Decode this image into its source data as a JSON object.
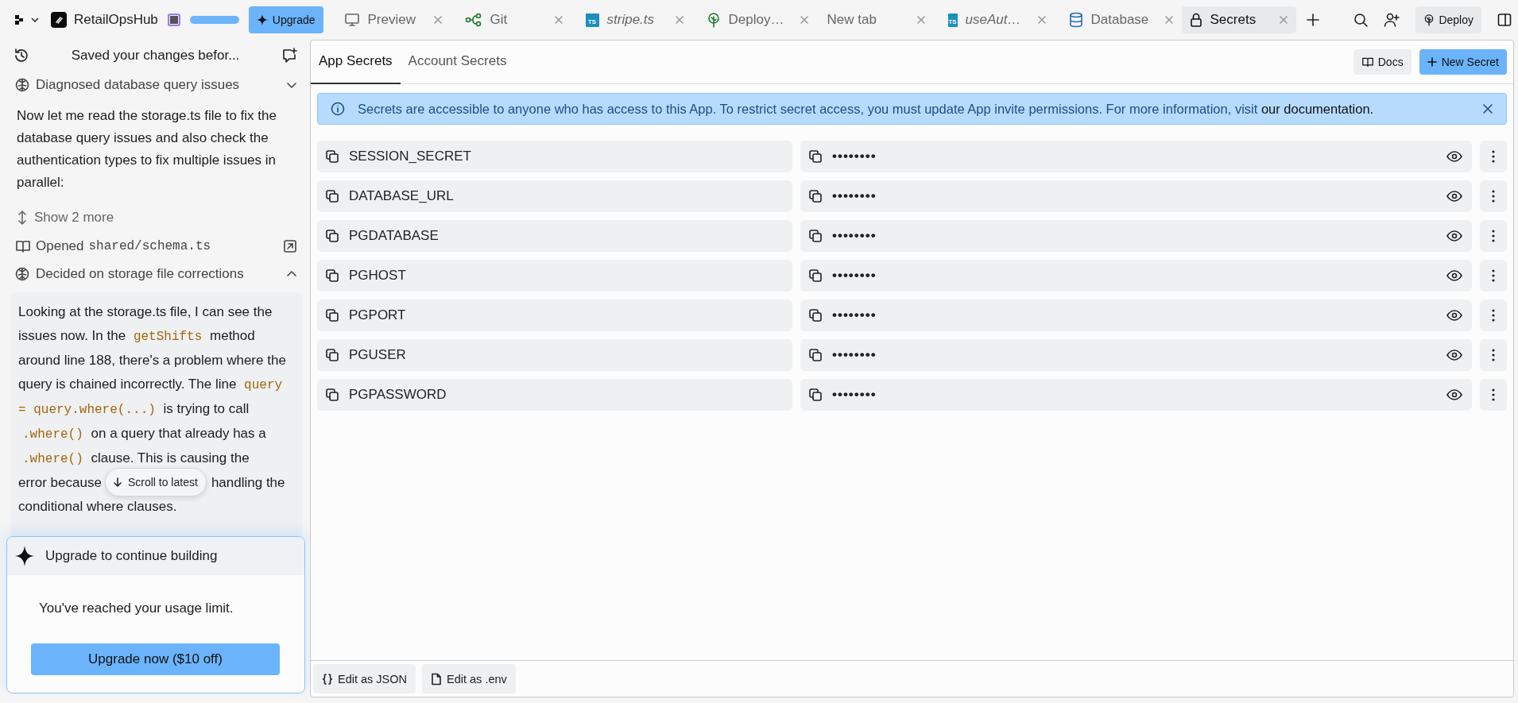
{
  "topbar": {
    "project": "RetailOpsHub",
    "upgrade": "Upgrade",
    "deploy": "Deploy",
    "tabs": [
      {
        "label": "Preview",
        "kind": "preview",
        "preview": false,
        "selected": false
      },
      {
        "label": "Git",
        "kind": "git",
        "preview": false,
        "selected": false
      },
      {
        "label": "stripe.ts",
        "kind": "file",
        "badge": "TS",
        "preview": true,
        "selected": false
      },
      {
        "label": "Deploy…",
        "kind": "deploy",
        "preview": false,
        "selected": false
      },
      {
        "label": "New tab",
        "kind": "blank",
        "preview": false,
        "selected": false
      },
      {
        "label": "useAut…",
        "kind": "file",
        "badge": "TS",
        "preview": true,
        "selected": false
      },
      {
        "label": "Database",
        "kind": "database",
        "preview": false,
        "selected": false
      },
      {
        "label": "Secrets",
        "kind": "secrets",
        "preview": false,
        "selected": true
      }
    ]
  },
  "chat": {
    "title": "Saved your changes befor...",
    "items": [
      {
        "kind": "step",
        "label": "Diagnosed database query issues",
        "expanded": false
      },
      {
        "kind": "paragraph",
        "text": "Now let me read the storage.ts file to fix the database query issues and also check the authentication types to fix multiple issues in parallel:"
      },
      {
        "kind": "more",
        "label": "Show 2 more"
      },
      {
        "kind": "file",
        "label": "Opened",
        "path": "shared/schema.ts"
      },
      {
        "kind": "step",
        "label": "Decided on storage file corrections",
        "expanded": true
      },
      {
        "kind": "card",
        "text": "Looking at the storage.ts file, I can see the issues now. In the *getShifts* method around line 188, there's a problem where the query is chained incorrectly. The line *query = query.where(...)* is trying to call *.where()* on a query that already has a *.where()* clause. This is causing the",
        "line_left": "error because",
        "line_right": "handling the",
        "text_end": "conditional where clauses.",
        "overlay": "Scroll to latest"
      }
    ],
    "upgrade_card": {
      "title": "Upgrade to continue building",
      "message": "You've reached your usage limit.",
      "button": "Upgrade now ($10 off)"
    }
  },
  "secrets": {
    "tabs": [
      {
        "label": "App Secrets",
        "selected": true
      },
      {
        "label": "Account Secrets",
        "selected": false
      }
    ],
    "docs": "Docs",
    "new_secret": "New Secret",
    "banner": {
      "text": "Secrets are accessible to anyone who has access to this App. To restrict secret access, you must update App invite permissions. For more information, visit",
      "link": "our documentation."
    },
    "rows": [
      {
        "name": "SESSION_SECRET",
        "value": "••••••••"
      },
      {
        "name": "DATABASE_URL",
        "value": "••••••••"
      },
      {
        "name": "PGDATABASE",
        "value": "••••••••"
      },
      {
        "name": "PGHOST",
        "value": "••••••••"
      },
      {
        "name": "PGPORT",
        "value": "••••••••"
      },
      {
        "name": "PGUSER",
        "value": "••••••••"
      },
      {
        "name": "PGPASSWORD",
        "value": "••••••••"
      }
    ],
    "footer": [
      {
        "label": "Edit as JSON",
        "kind": "json"
      },
      {
        "label": "Edit as .env",
        "kind": "env"
      }
    ]
  }
}
